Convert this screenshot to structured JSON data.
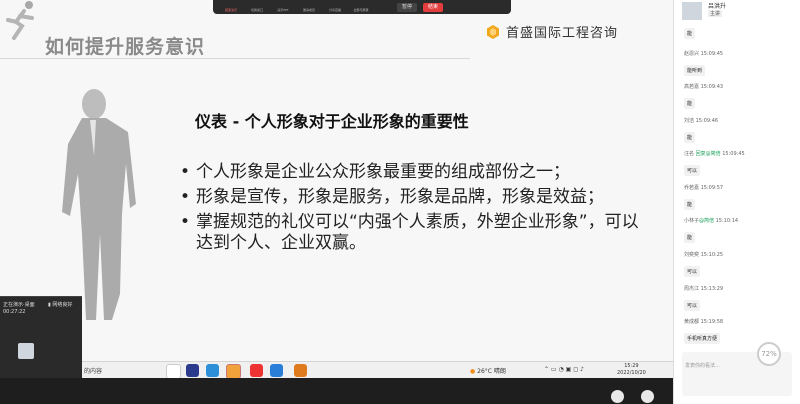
{
  "toolbar": {
    "items": [
      "结束演示",
      "切换窗口",
      "演示PPT",
      "邀请成员",
      "分享直播",
      "全部与屏幕"
    ],
    "pause_label": "暂停",
    "end_label": "结束"
  },
  "slide": {
    "title": "如何提升服务意识",
    "logo_text": "首盛国际工程咨询",
    "heading": "仪表 - 个人形象对于企业形象的重要性",
    "bullets": [
      "个人形象是企业公众形象最重要的组成部份之一；",
      "形象是宣传，形象是服务，形象是品牌，形象是效益；",
      "掌握规范的礼仪可以“内强个人素质，外塑企业形象”，可以达到个人、企业双赢。"
    ]
  },
  "share_tile": {
    "status": "正在演示·桌面",
    "time": "00:27:22",
    "network": "网络良好"
  },
  "taskbar": {
    "search_text": "的内容",
    "weather": "26°C 晴朗",
    "time": "15:29",
    "date": "2022/10/20"
  },
  "chat": {
    "host_name": "吕洪升",
    "host_badge": "主讲",
    "messages": [
      {
        "sender": "",
        "time": "",
        "text": "能"
      },
      {
        "sender": "赵恩兴",
        "time": "15:09:45",
        "text": "能听到"
      },
      {
        "sender": "高若嘉",
        "time": "15:09:43",
        "text": "能"
      },
      {
        "sender": "刘洁",
        "time": "15:09:46",
        "text": "能"
      },
      {
        "sender": "汪名",
        "reply": "回复@简倍",
        "time": "15:09:45",
        "text": "可以"
      },
      {
        "sender": "乔若嘉",
        "time": "15:09:57",
        "text": "能"
      },
      {
        "sender": "小林子",
        "reply": "@简倍",
        "time": "15:10:14",
        "text": "能"
      },
      {
        "sender": "刘奕奕",
        "time": "15:10:25",
        "text": "可以"
      },
      {
        "sender": "周杰江",
        "time": "15:13:29",
        "text": "可以"
      },
      {
        "sender": "黄成都",
        "time": "15:19:58",
        "text": "手机听真方便"
      }
    ],
    "input_placeholder": "发表你的看法…",
    "percent": "72"
  },
  "colors": {
    "accent_red": "#e33d3d",
    "reply_green": "#18a058"
  }
}
